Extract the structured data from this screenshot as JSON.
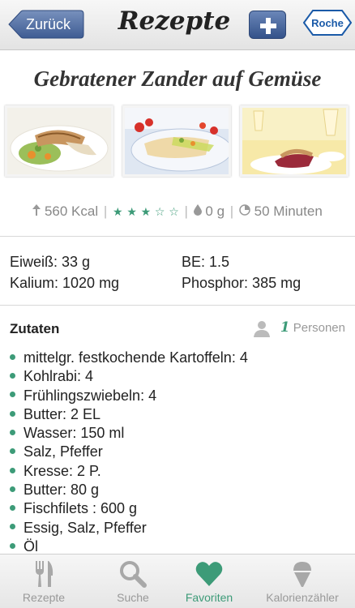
{
  "navbar": {
    "back_label": "Zurück",
    "title": "Rezepte",
    "add_icon": "plus-icon",
    "logo_text": "Roche"
  },
  "recipe": {
    "title": "Gebratener Zander auf Gemüse",
    "stats": {
      "calories": "560 Kcal",
      "rating": 3,
      "rating_max": 5,
      "fat": "0 g",
      "time": "50 Minuten"
    },
    "nutrition": {
      "protein": "Eiweiß: 33 g",
      "be": "BE: 1.5",
      "potassium": "Kalium: 1020 mg",
      "phosphorus": "Phosphor: 385 mg"
    },
    "ingredients_title": "Zutaten",
    "persons_count": "1",
    "persons_label": "Personen",
    "ingredients": [
      "mittelgr. festkochende Kartoffeln: 4",
      "Kohlrabi: 4",
      "Frühlingszwiebeln: 4",
      "Butter: 2 EL",
      "Wasser: 150 ml",
      "Salz, Pfeffer",
      "Kresse: 2 P.",
      "Butter: 80 g",
      "Fischfilets : 600 g",
      "Essig, Salz, Pfeffer",
      "Öl"
    ]
  },
  "tabbar": {
    "tabs": [
      {
        "label": "Rezepte",
        "icon": "fork-knife-icon"
      },
      {
        "label": "Suche",
        "icon": "search-icon"
      },
      {
        "label": "Favoriten",
        "icon": "heart-icon"
      },
      {
        "label": "Kalorienzähler",
        "icon": "ice-cream-icon"
      }
    ],
    "active_tab": "Favoriten"
  },
  "colors": {
    "accent": "#3d9b78",
    "button_blue": "#4a6aa5"
  }
}
